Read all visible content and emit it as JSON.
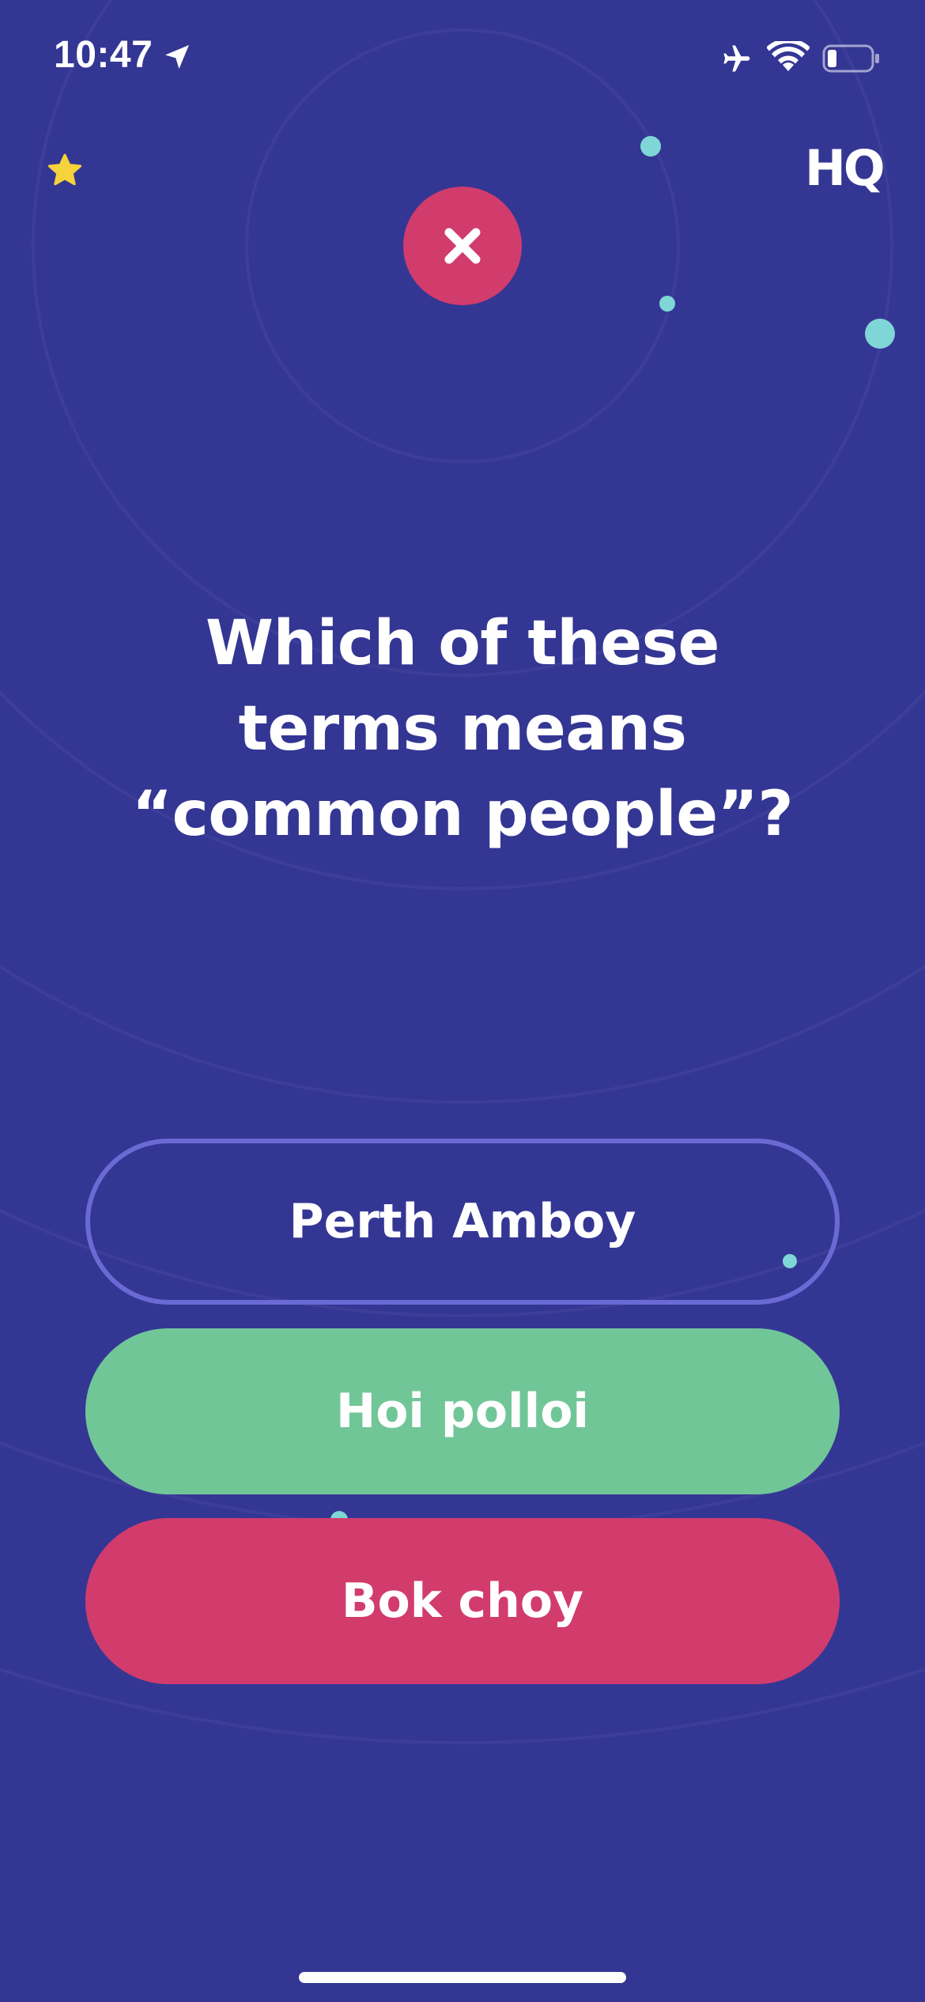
{
  "status_bar": {
    "time": "10:47",
    "icons": [
      "location-arrow-icon",
      "airplane-icon",
      "wifi-icon",
      "battery-icon"
    ]
  },
  "header": {
    "star_icon": "star-icon",
    "logo_text": "HQ",
    "result_icon": "close-icon"
  },
  "question": {
    "text": "Which of these terms means “common people”?"
  },
  "answers": [
    {
      "label": "Perth Amboy",
      "state": "unselected"
    },
    {
      "label": "Hoi polloi",
      "state": "correct"
    },
    {
      "label": "Bok choy",
      "state": "wrong"
    }
  ],
  "colors": {
    "background": "#343694",
    "correct": "#71c698",
    "wrong": "#d13c6d",
    "outline": "#6a6ad4",
    "accent_dot": "#7fd6d6",
    "star": "#f5d33b"
  }
}
